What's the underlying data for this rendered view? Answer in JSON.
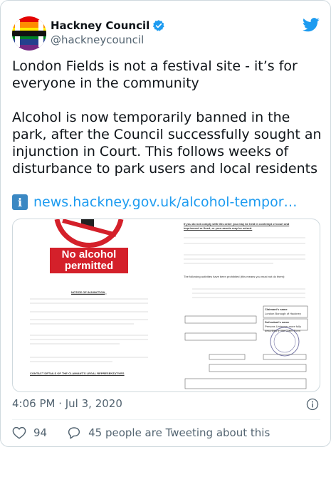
{
  "account": {
    "display_name": "Hackney Council",
    "handle": "@hackneycouncil",
    "verified": true
  },
  "tweet": {
    "text": "London Fields is not a festival site - it’s for everyone in the community\n\nAlcohol is now temporarily banned in the park, after the Council successfully sought an injunction in Court. This follows weeks of disturbance to park users and local residents",
    "link_text": "news.hackney.gov.uk/alcohol-tempor…",
    "timestamp": "4:06 PM · Jul 3, 2020"
  },
  "media": {
    "sign_text": "No alcohol permitted",
    "notice_heading": "NOTICE OF INJUNCTION",
    "contact_heading": "CONTACT DETAILS OF THE CLAIMANT'S LEGAL REPRESENTATIVES",
    "warning_text": "If you do not comply with this order you may be held in contempt of court and imprisoned or fined, or your assets may be seized.",
    "prohibited_text": "The following activities have been prohibited (this means you must not do them):",
    "claimant_label": "Claimant's name",
    "claimant_value": "London Borough of Hackney",
    "defendant_label": "Defendant's name",
    "defendant_value": "Persons Unknown more fully described in the Claim Form"
  },
  "actions": {
    "likes": "94",
    "conversation_text": "45 people are Tweeting about this"
  },
  "colors": {
    "link": "#1d9bf0",
    "verified": "#1d9bf0",
    "sign_red": "#d4202a",
    "muted": "#536471"
  }
}
